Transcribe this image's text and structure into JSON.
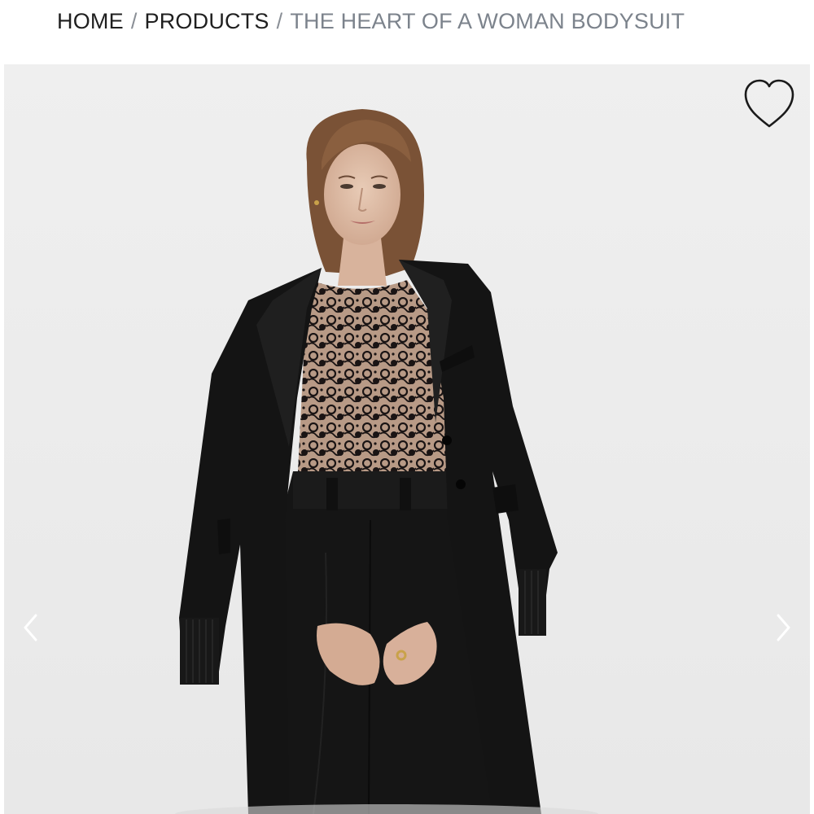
{
  "breadcrumb": {
    "items": [
      {
        "label": "HOME"
      },
      {
        "label": "PRODUCTS"
      }
    ],
    "separator": "/",
    "current": "THE HEART OF A WOMAN BODYSUIT"
  },
  "gallery": {
    "background_color": "#ececec",
    "wishlist_icon": "heart-outline-icon",
    "prev_icon": "chevron-left-icon",
    "next_icon": "chevron-right-icon"
  },
  "colors": {
    "text_primary": "#1f1f1f",
    "text_muted": "#7c838c",
    "garment_black": "#141414"
  }
}
